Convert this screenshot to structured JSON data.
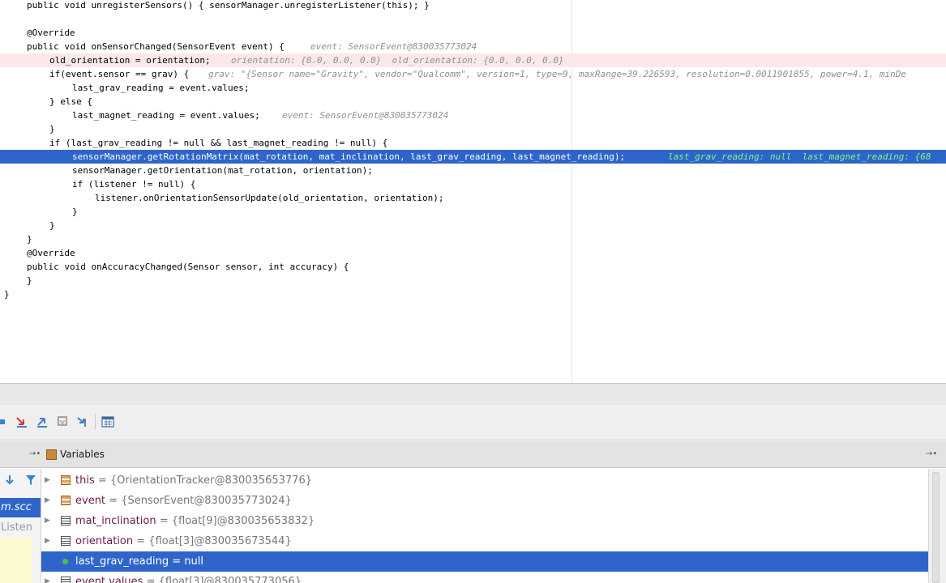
{
  "editor": {
    "lines": [
      {
        "indent": "  ",
        "text": "public void unregisterSensors() { sensorManager.unregisterListener(this); }"
      },
      {
        "indent": "",
        "text": ""
      },
      {
        "indent": "  ",
        "text": "@Override"
      },
      {
        "indent": "  ",
        "text": "public void onSensorChanged(SensorEvent event) {",
        "hint": "event: SensorEvent@830035773024"
      },
      {
        "indent": "    ",
        "text": "old_orientation = orientation;",
        "hint": "orientation: {0.0, 0.0, 0.0}  old_orientation: {0.0, 0.0, 0.0}"
      },
      {
        "indent": "    ",
        "text": "if(event.sensor == grav) {",
        "hint": "grav: \"{Sensor name=\"Gravity\", vendor=\"Qualcomm\", version=1, type=9, maxRange=39.226593, resolution=0.0011901855, power=4.1, minDe"
      },
      {
        "indent": "      ",
        "text": "last_grav_reading = event.values;"
      },
      {
        "indent": "    ",
        "text": "} else {"
      },
      {
        "indent": "      ",
        "text": "last_magnet_reading = event.values;",
        "hint": "event: SensorEvent@830035773024"
      },
      {
        "indent": "    ",
        "text": "}"
      },
      {
        "indent": "    ",
        "text": "if (last_grav_reading != null && last_magnet_reading != null) {"
      },
      {
        "indent": "      ",
        "text": "sensorManager.getRotationMatrix(mat_rotation, mat_inclination, last_grav_reading, last_magnet_reading);",
        "hint": "last_grav_reading: null  last_magnet_reading: {68"
      },
      {
        "indent": "      ",
        "text": "sensorManager.getOrientation(mat_rotation, orientation);"
      },
      {
        "indent": "      ",
        "text": "if (listener != null) {"
      },
      {
        "indent": "        ",
        "text": "listener.onOrientationSensorUpdate(old_orientation, orientation);"
      },
      {
        "indent": "      ",
        "text": "}"
      },
      {
        "indent": "    ",
        "text": "}"
      },
      {
        "indent": "  ",
        "text": "}"
      },
      {
        "indent": "  ",
        "text": "@Override"
      },
      {
        "indent": "  ",
        "text": "public void onAccuracyChanged(Sensor sensor, int accuracy) {"
      },
      {
        "indent": "  ",
        "text": "}"
      },
      {
        "indent": "",
        "text": "}"
      }
    ],
    "execution_line": 11,
    "breakpoint_line": 4
  },
  "debug_toolbar": {
    "buttons": [
      "show-execution-point-icon",
      "step-over-icon",
      "step-into-icon",
      "force-step-into-icon",
      "step-out-icon",
      "drop-frame-icon",
      "evaluate-expression-icon"
    ]
  },
  "variables_panel": {
    "title": "Variables",
    "frames": {
      "selected": "m.scc",
      "second": "Listen"
    },
    "rows": [
      {
        "name": "this",
        "value": "{OrientationTracker@830035653776}",
        "icon": "object-icon",
        "expandable": true
      },
      {
        "name": "event",
        "value": "{SensorEvent@830035773024}",
        "icon": "object-icon",
        "expandable": true
      },
      {
        "name": "mat_inclination",
        "value": "{float[9]@830035653832}",
        "icon": "array-icon",
        "expandable": true
      },
      {
        "name": "orientation",
        "value": "{float[3]@830035673544}",
        "icon": "array-icon",
        "expandable": true
      },
      {
        "name": "last_grav_reading",
        "value": "null",
        "icon": "null-icon",
        "expandable": false,
        "selected": true
      },
      {
        "name": "event.values",
        "value": "{float[3]@830035773056}",
        "icon": "array-icon",
        "expandable": true
      }
    ]
  },
  "colors": {
    "selection": "#2f65ca",
    "breakpoint_line": "#fbe9e9",
    "inline_hint": "#909090",
    "exec_hint": "#8ff08a"
  }
}
